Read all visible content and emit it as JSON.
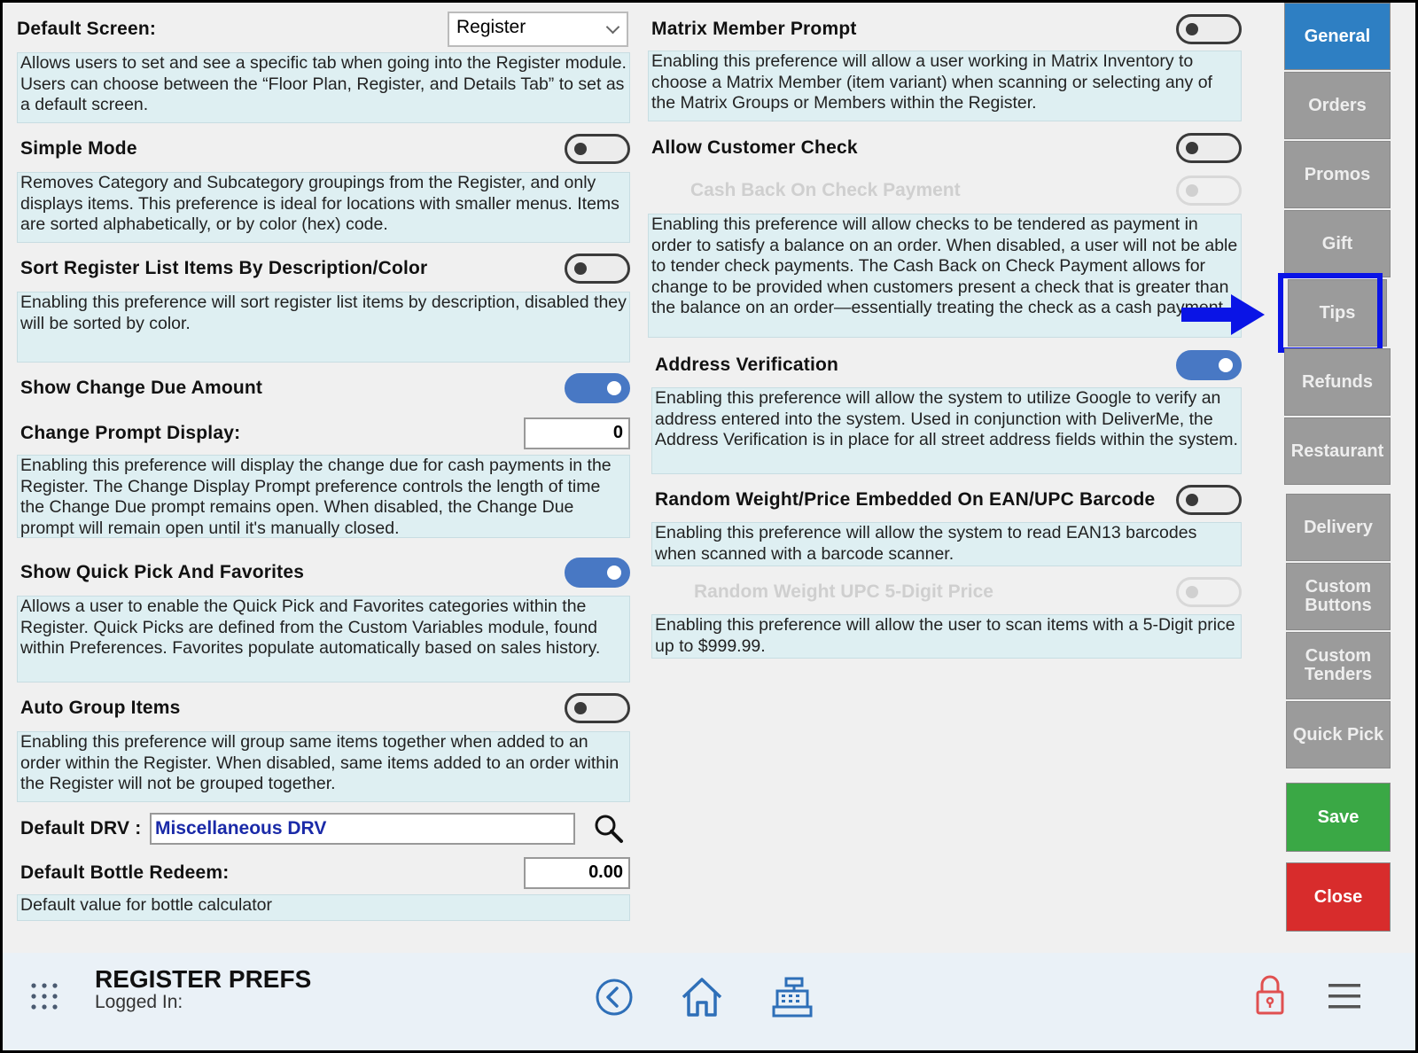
{
  "left": {
    "default_screen": {
      "label": "Default Screen:",
      "value": "Register",
      "desc": "Allows users to set and see a specific tab when going into the Register module. Users can choose between the “Floor Plan, Register, and Details Tab” to set as a default screen."
    },
    "simple_mode": {
      "label": "Simple Mode",
      "on": false,
      "desc": "Removes Category and Subcategory groupings from the Register, and only displays items. This preference is ideal for locations with smaller menus. Items are sorted alphabetically, or by color (hex) code."
    },
    "sort_register": {
      "label": "Sort Register List Items By Description/Color",
      "on": false,
      "desc": "Enabling this preference will sort register list items by description, disabled they will be sorted by color."
    },
    "show_change_due": {
      "label": "Show Change Due Amount",
      "on": true
    },
    "change_prompt": {
      "label": "Change Prompt Display:",
      "value": "0",
      "desc": "Enabling this preference will display the change due for cash payments in the Register. The Change Display Prompt preference controls the length of time the Change Due prompt remains open. When disabled, the Change Due prompt will remain open until it's manually closed."
    },
    "quick_pick": {
      "label": "Show Quick Pick And Favorites",
      "on": true,
      "desc": "Allows a user to enable the Quick Pick and Favorites categories within the Register. Quick Picks are defined from the Custom Variables module, found within Preferences. Favorites populate automatically based on sales history."
    },
    "auto_group": {
      "label": "Auto Group Items",
      "on": false,
      "desc": "Enabling this preference will group same items together when added to an order within the Register. When disabled, same items added to an order within the Register will not be grouped together."
    },
    "default_drv": {
      "label": "Default DRV :",
      "value": "Miscellaneous DRV"
    },
    "bottle_redeem": {
      "label": "Default Bottle Redeem:",
      "value": "0.00",
      "desc": "Default value for bottle calculator"
    }
  },
  "right": {
    "matrix": {
      "label": "Matrix Member Prompt",
      "on": false,
      "desc": "Enabling this preference will allow a user working in Matrix Inventory to choose a Matrix Member (item variant) when scanning or selecting any of the Matrix Groups or Members within the Register."
    },
    "customer_check": {
      "label": "Allow Customer Check",
      "on": false
    },
    "cash_back": {
      "label": "Cash Back On Check Payment",
      "on": false,
      "desc": "Enabling this preference will allow checks to be tendered as payment in order to satisfy a balance on an order. When disabled, a user will not be able to tender check payments. The Cash Back on Check Payment allows for change to be provided when customers present a check that is greater than the balance on an order—essentially treating the check as a cash payment."
    },
    "address": {
      "label": "Address Verification",
      "on": true,
      "desc": "Enabling this preference will allow the system to utilize Google to verify an address entered into the system. Used in conjunction with DeliverMe, the Address Verification is in place for all street address fields within the system."
    },
    "random_weight": {
      "label": "Random Weight/Price Embedded On EAN/UPC Barcode",
      "on": false,
      "desc": "Enabling this preference will allow the system to read EAN13 barcodes when scanned with a barcode scanner."
    },
    "five_digit": {
      "label": "Random Weight UPC 5-Digit Price",
      "on": false,
      "desc": "Enabling this preference will allow the user to scan items with a 5-Digit price up to $999.99."
    }
  },
  "sidebar": {
    "general": "General",
    "orders": "Orders",
    "promos": "Promos",
    "gift": "Gift",
    "tips": "Tips",
    "refunds": "Refunds",
    "restaurant": "Restaurant",
    "delivery": "Delivery",
    "custom_buttons": "Custom Buttons",
    "custom_tenders": "Custom Tenders",
    "quick_pick": "Quick Pick",
    "save": "Save",
    "close": "Close"
  },
  "footer": {
    "title": "REGISTER PREFS",
    "logged_in": "Logged In:"
  },
  "colors": {
    "active_tab": "#2e7fc3",
    "save": "#3aa845",
    "close": "#d82c2c",
    "highlight": "#0a14e6",
    "toggle_on": "#4878c4"
  }
}
